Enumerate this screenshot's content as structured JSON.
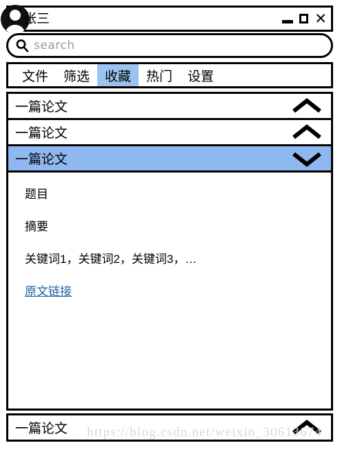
{
  "window": {
    "user_name": "张三",
    "avatar_icon": "user-avatar-icon",
    "controls": {
      "minimize_label": "—",
      "maximize_label": "▢",
      "close_label": "✕"
    }
  },
  "search": {
    "icon": "search-icon",
    "placeholder": "search",
    "value": ""
  },
  "tabs": [
    {
      "label": "文件",
      "active": false
    },
    {
      "label": "筛选",
      "active": false
    },
    {
      "label": "收藏",
      "active": true
    },
    {
      "label": "热门",
      "active": false
    },
    {
      "label": "设置",
      "active": false
    }
  ],
  "paper_list": [
    {
      "title": "一篇论文",
      "expanded": false,
      "selected": false,
      "chevron": "chevron-up-icon"
    },
    {
      "title": "一篇论文",
      "expanded": false,
      "selected": false,
      "chevron": "chevron-up-icon"
    },
    {
      "title": "一篇论文",
      "expanded": true,
      "selected": true,
      "chevron": "chevron-down-icon"
    },
    {
      "title": "一篇论文",
      "expanded": false,
      "selected": false,
      "chevron": "chevron-up-icon"
    }
  ],
  "detail": {
    "title_label": "题目",
    "abstract_label": "摘要",
    "keywords": "关键词1，关键词2，关键词3，…",
    "link_label": "原文链接"
  },
  "watermark": {
    "text": "https://blog.csdn.net/weixin_30613674"
  },
  "colors": {
    "accent_tab": "#9CC3F0",
    "accent_row": "#90B8F0",
    "link": "#1F5FA8",
    "border": "#000000",
    "placeholder": "#9b9b9b",
    "watermark": "#d8d8d8"
  }
}
